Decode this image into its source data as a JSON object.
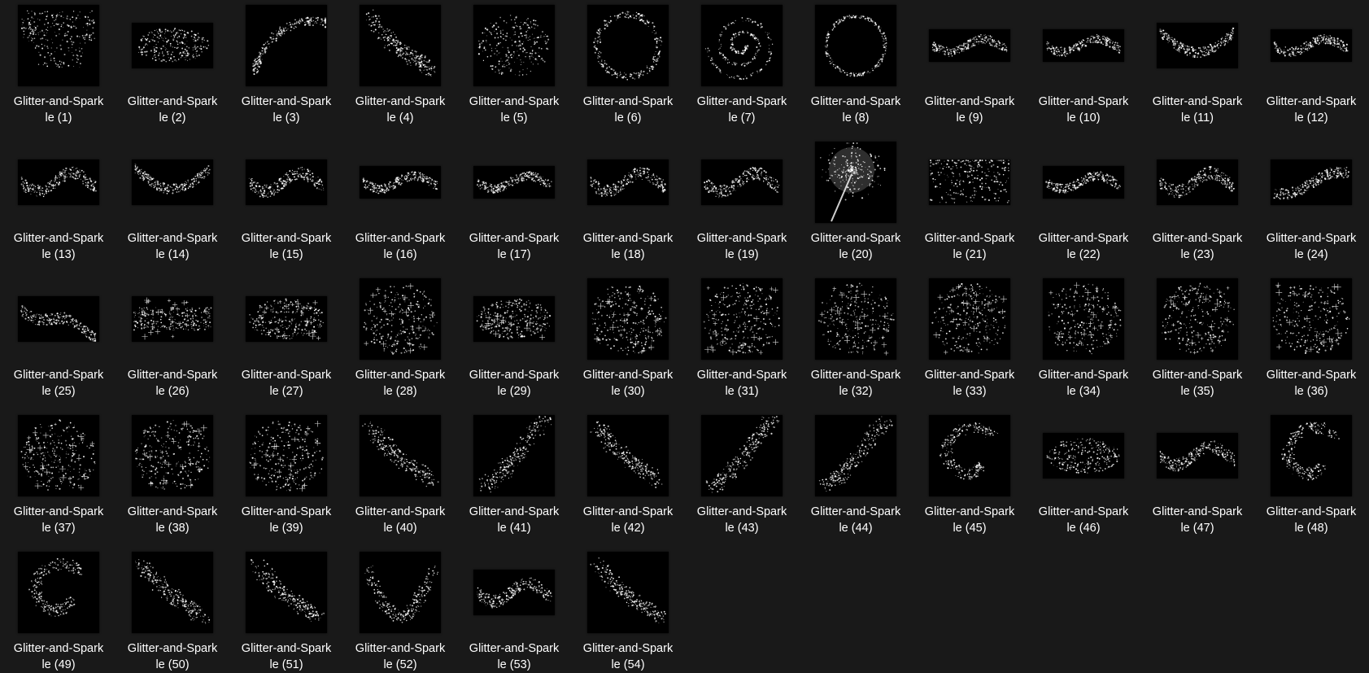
{
  "view": "file-explorer-large-icons",
  "items": [
    {
      "name": "Glitter-and-Sparkle (1)",
      "line1": "Glitter-and-Spark",
      "line2": "le (1)",
      "shape": "heart-cloud",
      "aspect": "square"
    },
    {
      "name": "Glitter-and-Sparkle (2)",
      "line1": "Glitter-and-Spark",
      "line2": "le (2)",
      "shape": "oval-cloud",
      "aspect": "wide"
    },
    {
      "name": "Glitter-and-Sparkle (3)",
      "line1": "Glitter-and-Spark",
      "line2": "le (3)",
      "shape": "arc-swoosh",
      "aspect": "square"
    },
    {
      "name": "Glitter-and-Sparkle (4)",
      "line1": "Glitter-and-Spark",
      "line2": "le (4)",
      "shape": "diagonal-band",
      "aspect": "square"
    },
    {
      "name": "Glitter-and-Sparkle (5)",
      "line1": "Glitter-and-Spark",
      "line2": "le (5)",
      "shape": "oval-cloud",
      "aspect": "square"
    },
    {
      "name": "Glitter-and-Sparkle (6)",
      "line1": "Glitter-and-Spark",
      "line2": "le (6)",
      "shape": "ring",
      "aspect": "square"
    },
    {
      "name": "Glitter-and-Sparkle (7)",
      "line1": "Glitter-and-Spark",
      "line2": "le (7)",
      "shape": "spiral",
      "aspect": "square"
    },
    {
      "name": "Glitter-and-Sparkle (8)",
      "line1": "Glitter-and-Spark",
      "line2": "le (8)",
      "shape": "thin-ring",
      "aspect": "square"
    },
    {
      "name": "Glitter-and-Sparkle (9)",
      "line1": "Glitter-and-Spark",
      "line2": "le (9)",
      "shape": "wave",
      "aspect": "strip"
    },
    {
      "name": "Glitter-and-Sparkle (10)",
      "line1": "Glitter-and-Spark",
      "line2": "le (10)",
      "shape": "wave",
      "aspect": "strip"
    },
    {
      "name": "Glitter-and-Sparkle (11)",
      "line1": "Glitter-and-Spark",
      "line2": "le (11)",
      "shape": "smile-curve",
      "aspect": "wide"
    },
    {
      "name": "Glitter-and-Sparkle (12)",
      "line1": "Glitter-and-Spark",
      "line2": "le (12)",
      "shape": "wave",
      "aspect": "strip"
    },
    {
      "name": "Glitter-and-Sparkle (13)",
      "line1": "Glitter-and-Spark",
      "line2": "le (13)",
      "shape": "wave",
      "aspect": "wide"
    },
    {
      "name": "Glitter-and-Sparkle (14)",
      "line1": "Glitter-and-Spark",
      "line2": "le (14)",
      "shape": "smile-curve",
      "aspect": "wide"
    },
    {
      "name": "Glitter-and-Sparkle (15)",
      "line1": "Glitter-and-Spark",
      "line2": "le (15)",
      "shape": "wave",
      "aspect": "wide"
    },
    {
      "name": "Glitter-and-Sparkle (16)",
      "line1": "Glitter-and-Spark",
      "line2": "le (16)",
      "shape": "wave",
      "aspect": "strip"
    },
    {
      "name": "Glitter-and-Sparkle (17)",
      "line1": "Glitter-and-Spark",
      "line2": "le (17)",
      "shape": "wave",
      "aspect": "strip"
    },
    {
      "name": "Glitter-and-Sparkle (18)",
      "line1": "Glitter-and-Spark",
      "line2": "le (18)",
      "shape": "wave",
      "aspect": "wide"
    },
    {
      "name": "Glitter-and-Sparkle (19)",
      "line1": "Glitter-and-Spark",
      "line2": "le (19)",
      "shape": "wave",
      "aspect": "wide"
    },
    {
      "name": "Glitter-and-Sparkle (20)",
      "line1": "Glitter-and-Spark",
      "line2": "le (20)",
      "shape": "wand",
      "aspect": "square"
    },
    {
      "name": "Glitter-and-Sparkle (21)",
      "line1": "Glitter-and-Spark",
      "line2": "le (21)",
      "shape": "rain",
      "aspect": "wide"
    },
    {
      "name": "Glitter-and-Sparkle (22)",
      "line1": "Glitter-and-Spark",
      "line2": "le (22)",
      "shape": "wave",
      "aspect": "strip"
    },
    {
      "name": "Glitter-and-Sparkle (23)",
      "line1": "Glitter-and-Spark",
      "line2": "le (23)",
      "shape": "wave",
      "aspect": "wide"
    },
    {
      "name": "Glitter-and-Sparkle (24)",
      "line1": "Glitter-and-Spark",
      "line2": "le (24)",
      "shape": "rising-wave",
      "aspect": "wide"
    },
    {
      "name": "Glitter-and-Sparkle (25)",
      "line1": "Glitter-and-Spark",
      "line2": "le (25)",
      "shape": "falling-wave",
      "aspect": "wide"
    },
    {
      "name": "Glitter-and-Sparkle (26)",
      "line1": "Glitter-and-Spark",
      "line2": "le (26)",
      "shape": "star-band",
      "aspect": "wide"
    },
    {
      "name": "Glitter-and-Sparkle (27)",
      "line1": "Glitter-and-Spark",
      "line2": "le (27)",
      "shape": "star-field",
      "aspect": "wide"
    },
    {
      "name": "Glitter-and-Sparkle (28)",
      "line1": "Glitter-and-Spark",
      "line2": "le (28)",
      "shape": "star-field",
      "aspect": "square"
    },
    {
      "name": "Glitter-and-Sparkle (29)",
      "line1": "Glitter-and-Spark",
      "line2": "le (29)",
      "shape": "star-field",
      "aspect": "wide"
    },
    {
      "name": "Glitter-and-Sparkle (30)",
      "line1": "Glitter-and-Spark",
      "line2": "le (30)",
      "shape": "star-field",
      "aspect": "square"
    },
    {
      "name": "Glitter-and-Sparkle (31)",
      "line1": "Glitter-and-Spark",
      "line2": "le (31)",
      "shape": "star-field",
      "aspect": "square"
    },
    {
      "name": "Glitter-and-Sparkle (32)",
      "line1": "Glitter-and-Spark",
      "line2": "le (32)",
      "shape": "star-field",
      "aspect": "square"
    },
    {
      "name": "Glitter-and-Sparkle (33)",
      "line1": "Glitter-and-Spark",
      "line2": "le (33)",
      "shape": "star-field",
      "aspect": "square"
    },
    {
      "name": "Glitter-and-Sparkle (34)",
      "line1": "Glitter-and-Spark",
      "line2": "le (34)",
      "shape": "star-field",
      "aspect": "square"
    },
    {
      "name": "Glitter-and-Sparkle (35)",
      "line1": "Glitter-and-Spark",
      "line2": "le (35)",
      "shape": "star-field",
      "aspect": "square"
    },
    {
      "name": "Glitter-and-Sparkle (36)",
      "line1": "Glitter-and-Spark",
      "line2": "le (36)",
      "shape": "star-field",
      "aspect": "square"
    },
    {
      "name": "Glitter-and-Sparkle (37)",
      "line1": "Glitter-and-Spark",
      "line2": "le (37)",
      "shape": "star-field",
      "aspect": "square"
    },
    {
      "name": "Glitter-and-Sparkle (38)",
      "line1": "Glitter-and-Spark",
      "line2": "le (38)",
      "shape": "star-field",
      "aspect": "square"
    },
    {
      "name": "Glitter-and-Sparkle (39)",
      "line1": "Glitter-and-Spark",
      "line2": "le (39)",
      "shape": "star-field",
      "aspect": "square"
    },
    {
      "name": "Glitter-and-Sparkle (40)",
      "line1": "Glitter-and-Spark",
      "line2": "le (40)",
      "shape": "diagonal-band",
      "aspect": "square"
    },
    {
      "name": "Glitter-and-Sparkle (41)",
      "line1": "Glitter-and-Spark",
      "line2": "le (41)",
      "shape": "rising-band",
      "aspect": "square"
    },
    {
      "name": "Glitter-and-Sparkle (42)",
      "line1": "Glitter-and-Spark",
      "line2": "le (42)",
      "shape": "diagonal-band",
      "aspect": "square"
    },
    {
      "name": "Glitter-and-Sparkle (43)",
      "line1": "Glitter-and-Spark",
      "line2": "le (43)",
      "shape": "rising-band",
      "aspect": "square"
    },
    {
      "name": "Glitter-and-Sparkle (44)",
      "line1": "Glitter-and-Spark",
      "line2": "le (44)",
      "shape": "rising-band",
      "aspect": "square"
    },
    {
      "name": "Glitter-and-Sparkle (45)",
      "line1": "Glitter-and-Spark",
      "line2": "le (45)",
      "shape": "swirl",
      "aspect": "square"
    },
    {
      "name": "Glitter-and-Sparkle (46)",
      "line1": "Glitter-and-Spark",
      "line2": "le (46)",
      "shape": "oval-cloud",
      "aspect": "wide"
    },
    {
      "name": "Glitter-and-Sparkle (47)",
      "line1": "Glitter-and-Spark",
      "line2": "le (47)",
      "shape": "wave",
      "aspect": "wide"
    },
    {
      "name": "Glitter-and-Sparkle (48)",
      "line1": "Glitter-and-Spark",
      "line2": "le (48)",
      "shape": "swirl",
      "aspect": "square"
    },
    {
      "name": "Glitter-and-Sparkle (49)",
      "line1": "Glitter-and-Spark",
      "line2": "le (49)",
      "shape": "swirl",
      "aspect": "square"
    },
    {
      "name": "Glitter-and-Sparkle (50)",
      "line1": "Glitter-and-Spark",
      "line2": "le (50)",
      "shape": "diagonal-band",
      "aspect": "square"
    },
    {
      "name": "Glitter-and-Sparkle (51)",
      "line1": "Glitter-and-Spark",
      "line2": "le (51)",
      "shape": "diagonal-band",
      "aspect": "square"
    },
    {
      "name": "Glitter-and-Sparkle (52)",
      "line1": "Glitter-and-Spark",
      "line2": "le (52)",
      "shape": "v-curve",
      "aspect": "square"
    },
    {
      "name": "Glitter-and-Sparkle (53)",
      "line1": "Glitter-and-Spark",
      "line2": "le (53)",
      "shape": "wave",
      "aspect": "wide"
    },
    {
      "name": "Glitter-and-Sparkle (54)",
      "line1": "Glitter-and-Spark",
      "line2": "le (54)",
      "shape": "diagonal-band",
      "aspect": "square"
    }
  ]
}
